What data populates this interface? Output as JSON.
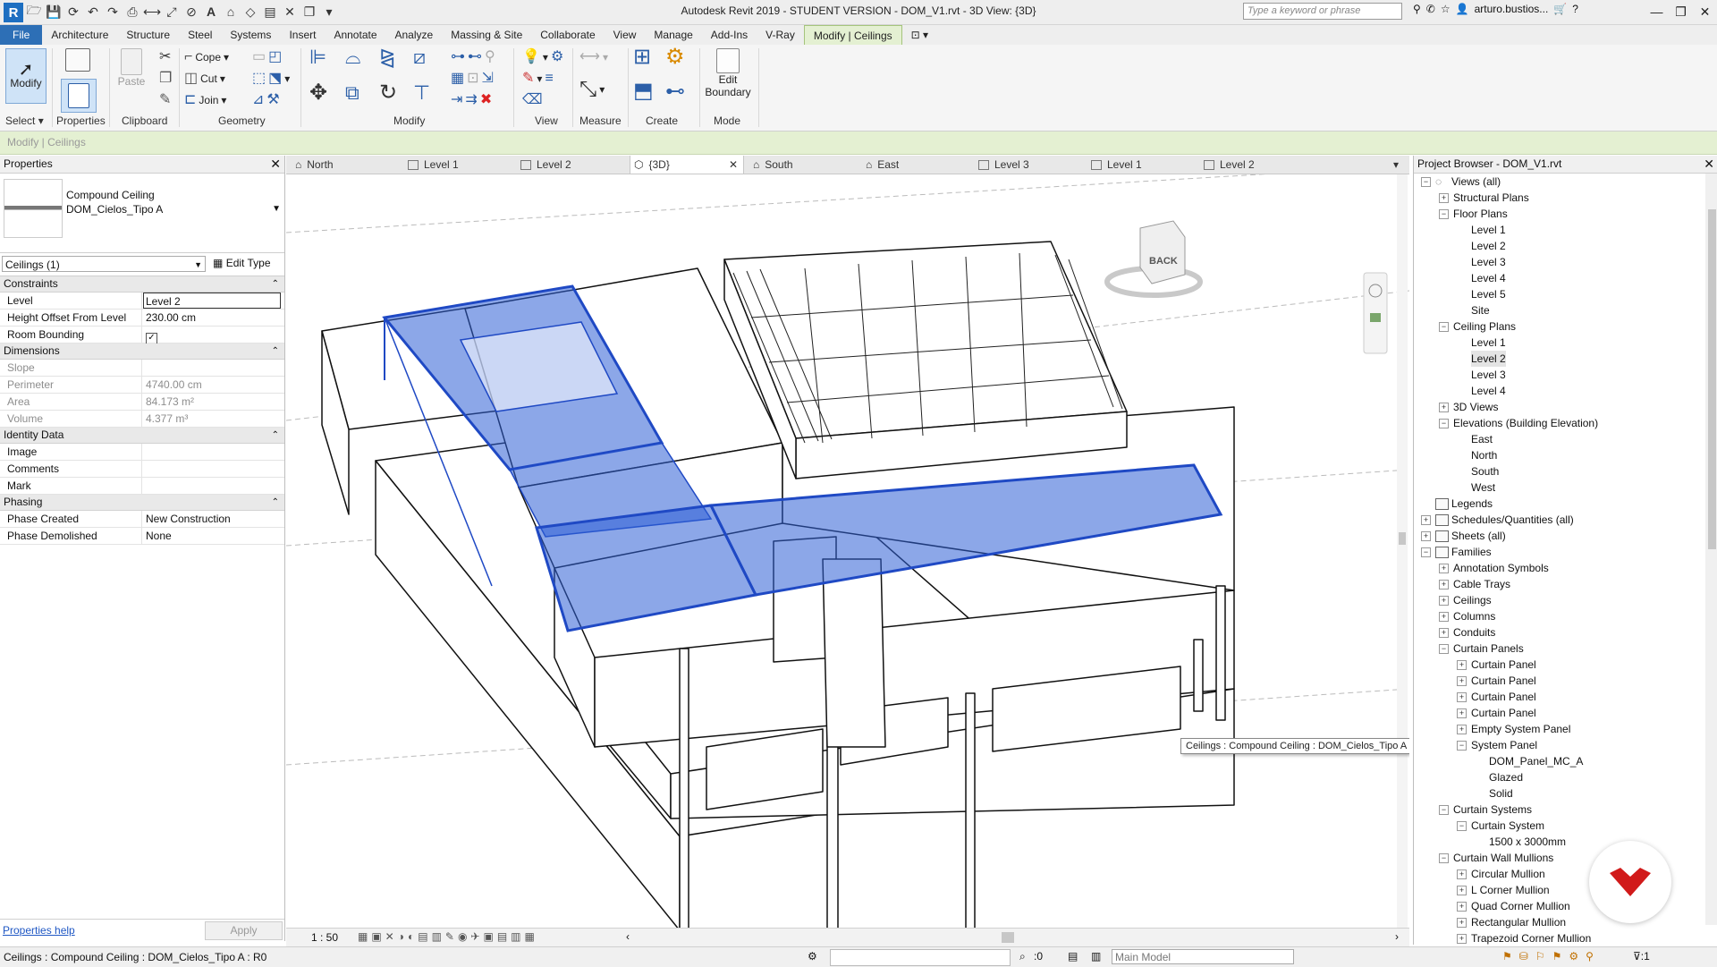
{
  "titlebar": {
    "title": "Autodesk Revit 2019 - STUDENT VERSION - DOM_V1.rvt - 3D View: {3D}",
    "search_placeholder": "Type a keyword or phrase",
    "user": "arturo.bustios..."
  },
  "ribbon_tabs": [
    "File",
    "Architecture",
    "Structure",
    "Steel",
    "Systems",
    "Insert",
    "Annotate",
    "Analyze",
    "Massing & Site",
    "Collaborate",
    "View",
    "Manage",
    "Add-Ins",
    "V-Ray",
    "Modify | Ceilings"
  ],
  "ribbon": {
    "modify": "Modify",
    "select": "Select",
    "properties": "Properties",
    "paste": "Paste",
    "cope": "Cope",
    "cut": "Cut",
    "join": "Join",
    "clipboard": "Clipboard",
    "geometry": "Geometry",
    "modify_panel": "Modify",
    "view": "View",
    "measure": "Measure",
    "create": "Create",
    "edit_boundary_1": "Edit",
    "edit_boundary_2": "Boundary",
    "mode": "Mode"
  },
  "options_bar": "Modify | Ceilings",
  "properties": {
    "title": "Properties",
    "type_line1": "Compound Ceiling",
    "type_line2": "DOM_Cielos_Tipo A",
    "instance_filter": "Ceilings (1)",
    "edit_type": "Edit Type",
    "groups": {
      "constraints": "Constraints",
      "dimensions": "Dimensions",
      "identity": "Identity Data",
      "phasing": "Phasing"
    },
    "rows": {
      "level": {
        "name": "Level",
        "value": "Level 2"
      },
      "height_offset": {
        "name": "Height Offset From Level",
        "value": "230.00 cm"
      },
      "room_bounding": {
        "name": "Room Bounding",
        "value": "✓"
      },
      "slope": {
        "name": "Slope",
        "value": ""
      },
      "perimeter": {
        "name": "Perimeter",
        "value": "4740.00 cm"
      },
      "area": {
        "name": "Area",
        "value": "84.173 m²"
      },
      "volume": {
        "name": "Volume",
        "value": "4.377 m³"
      },
      "image": {
        "name": "Image",
        "value": ""
      },
      "comments": {
        "name": "Comments",
        "value": ""
      },
      "mark": {
        "name": "Mark",
        "value": ""
      },
      "phase_created": {
        "name": "Phase Created",
        "value": "New Construction"
      },
      "phase_demolished": {
        "name": "Phase Demolished",
        "value": "None"
      }
    },
    "help": "Properties help",
    "apply": "Apply"
  },
  "view_tabs": [
    "North",
    "Level 1",
    "Level 2",
    "{3D}",
    "South",
    "East",
    "Level 3",
    "Level 1",
    "Level 2"
  ],
  "viewcube_face": "BACK",
  "tooltip": "Ceilings : Compound Ceiling : DOM_Cielos_Tipo A : R0",
  "viewbar": {
    "scale": "1 : 50"
  },
  "browser": {
    "title": "Project Browser - DOM_V1.rvt",
    "items": [
      {
        "label": "Views (all)",
        "level": 0,
        "toggle": "−"
      },
      {
        "label": "Structural Plans",
        "level": 1,
        "toggle": "+"
      },
      {
        "label": "Floor Plans",
        "level": 1,
        "toggle": "−"
      },
      {
        "label": "Level 1",
        "level": 2,
        "toggle": ""
      },
      {
        "label": "Level 2",
        "level": 2,
        "toggle": ""
      },
      {
        "label": "Level 3",
        "level": 2,
        "toggle": ""
      },
      {
        "label": "Level 4",
        "level": 2,
        "toggle": ""
      },
      {
        "label": "Level 5",
        "level": 2,
        "toggle": ""
      },
      {
        "label": "Site",
        "level": 2,
        "toggle": ""
      },
      {
        "label": "Ceiling Plans",
        "level": 1,
        "toggle": "−"
      },
      {
        "label": "Level 1",
        "level": 2,
        "toggle": ""
      },
      {
        "label": "Level 2",
        "level": 2,
        "toggle": "",
        "selected": true
      },
      {
        "label": "Level 3",
        "level": 2,
        "toggle": ""
      },
      {
        "label": "Level 4",
        "level": 2,
        "toggle": ""
      },
      {
        "label": "3D Views",
        "level": 1,
        "toggle": "+"
      },
      {
        "label": "Elevations (Building Elevation)",
        "level": 1,
        "toggle": "−"
      },
      {
        "label": "East",
        "level": 2,
        "toggle": ""
      },
      {
        "label": "North",
        "level": 2,
        "toggle": ""
      },
      {
        "label": "South",
        "level": 2,
        "toggle": ""
      },
      {
        "label": "West",
        "level": 2,
        "toggle": ""
      },
      {
        "label": "Legends",
        "level": 0,
        "toggle": "",
        "icon": true
      },
      {
        "label": "Schedules/Quantities (all)",
        "level": 0,
        "toggle": "+",
        "icon": true
      },
      {
        "label": "Sheets (all)",
        "level": 0,
        "toggle": "+",
        "icon": true
      },
      {
        "label": "Families",
        "level": 0,
        "toggle": "−",
        "icon": true
      },
      {
        "label": "Annotation Symbols",
        "level": 1,
        "toggle": "+"
      },
      {
        "label": "Cable Trays",
        "level": 1,
        "toggle": "+"
      },
      {
        "label": "Ceilings",
        "level": 1,
        "toggle": "+"
      },
      {
        "label": "Columns",
        "level": 1,
        "toggle": "+"
      },
      {
        "label": "Conduits",
        "level": 1,
        "toggle": "+"
      },
      {
        "label": "Curtain Panels",
        "level": 1,
        "toggle": "−"
      },
      {
        "label": "Curtain Panel",
        "level": 2,
        "toggle": "+"
      },
      {
        "label": "Curtain Panel",
        "level": 2,
        "toggle": "+"
      },
      {
        "label": "Curtain Panel",
        "level": 2,
        "toggle": "+"
      },
      {
        "label": "Curtain Panel",
        "level": 2,
        "toggle": "+"
      },
      {
        "label": "Empty System Panel",
        "level": 2,
        "toggle": "+"
      },
      {
        "label": "System Panel",
        "level": 2,
        "toggle": "−"
      },
      {
        "label": "DOM_Panel_MC_A",
        "level": 3,
        "toggle": ""
      },
      {
        "label": "Glazed",
        "level": 3,
        "toggle": ""
      },
      {
        "label": "Solid",
        "level": 3,
        "toggle": ""
      },
      {
        "label": "Curtain Systems",
        "level": 1,
        "toggle": "−"
      },
      {
        "label": "Curtain System",
        "level": 2,
        "toggle": "−"
      },
      {
        "label": "1500 x 3000mm",
        "level": 3,
        "toggle": ""
      },
      {
        "label": "Curtain Wall Mullions",
        "level": 1,
        "toggle": "−"
      },
      {
        "label": "Circular Mullion",
        "level": 2,
        "toggle": "+"
      },
      {
        "label": "L Corner Mullion",
        "level": 2,
        "toggle": "+"
      },
      {
        "label": "Quad Corner Mullion",
        "level": 2,
        "toggle": "+"
      },
      {
        "label": "Rectangular Mullion",
        "level": 2,
        "toggle": "+"
      },
      {
        "label": "Trapezoid Corner Mullion",
        "level": 2,
        "toggle": "+"
      }
    ]
  },
  "statusbar": {
    "text": "Ceilings : Compound Ceiling : DOM_Cielos_Tipo A : R0",
    "count": ":0",
    "model": "Main Model"
  },
  "colors": {
    "selection": "#2e5fd6",
    "file_tab": "#2d6fb6",
    "context_tab": "#e4f0d2"
  }
}
